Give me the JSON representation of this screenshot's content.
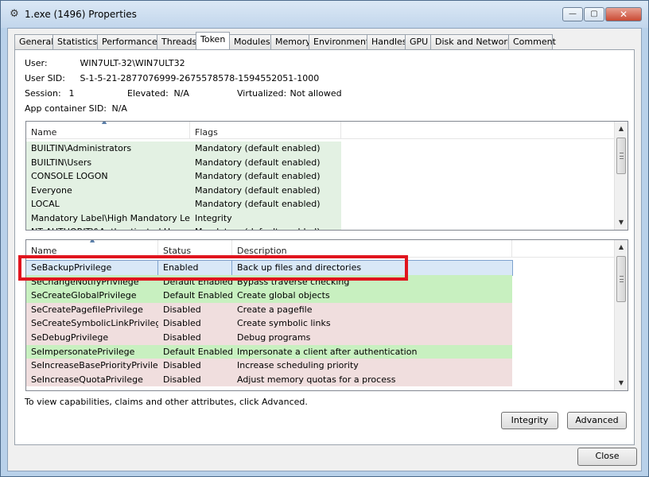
{
  "window": {
    "title": "1.exe (1496) Properties",
    "close_label": "✕",
    "minimize_label": "—",
    "maximize_label": "▢"
  },
  "tabs": [
    "General",
    "Statistics",
    "Performance",
    "Threads",
    "Token",
    "Modules",
    "Memory",
    "Environment",
    "Handles",
    "GPU",
    "Disk and Network",
    "Comment"
  ],
  "active_tab": "Token",
  "info": {
    "user_label": "User:",
    "user_value": "WIN7ULT-32\\WIN7ULT32",
    "sid_label": "User SID:",
    "sid_value": "S-1-5-21-2877076999-2675578578-1594552051-1000",
    "session_label": "Session:",
    "session_value": "1",
    "elevated_label": "Elevated:",
    "elevated_value": "N/A",
    "virtualized_label": "Virtualized:",
    "virtualized_value": "Not allowed",
    "appcontainer_label": "App container SID:",
    "appcontainer_value": "N/A"
  },
  "groups": {
    "columns": [
      "Name",
      "Flags"
    ],
    "rows": [
      {
        "name": "BUILTIN\\Administrators",
        "flags": "Mandatory (default enabled)"
      },
      {
        "name": "BUILTIN\\Users",
        "flags": "Mandatory (default enabled)"
      },
      {
        "name": "CONSOLE LOGON",
        "flags": "Mandatory (default enabled)"
      },
      {
        "name": "Everyone",
        "flags": "Mandatory (default enabled)"
      },
      {
        "name": "LOCAL",
        "flags": "Mandatory (default enabled)"
      },
      {
        "name": "Mandatory Label\\High Mandatory Level",
        "flags": "Integrity"
      },
      {
        "name": "NT AUTHORITY\\Authenticated Users",
        "flags": "Mandatory (default enabled)"
      }
    ]
  },
  "privileges": {
    "columns": [
      "Name",
      "Status",
      "Description"
    ],
    "rows": [
      {
        "name": "SeBackupPrivilege",
        "status": "Enabled",
        "description": "Back up files and directories",
        "state": "selected"
      },
      {
        "name": "SeChangeNotifyPrivilege",
        "status": "Default Enabled",
        "description": "Bypass traverse checking",
        "state": "default"
      },
      {
        "name": "SeCreateGlobalPrivilege",
        "status": "Default Enabled",
        "description": "Create global objects",
        "state": "default"
      },
      {
        "name": "SeCreatePagefilePrivilege",
        "status": "Disabled",
        "description": "Create a pagefile",
        "state": "disabled"
      },
      {
        "name": "SeCreateSymbolicLinkPrivilege",
        "status": "Disabled",
        "description": "Create symbolic links",
        "state": "disabled"
      },
      {
        "name": "SeDebugPrivilege",
        "status": "Disabled",
        "description": "Debug programs",
        "state": "disabled"
      },
      {
        "name": "SeImpersonatePrivilege",
        "status": "Default Enabled",
        "description": "Impersonate a client after authentication",
        "state": "default"
      },
      {
        "name": "SeIncreaseBasePriorityPrivilege",
        "status": "Disabled",
        "description": "Increase scheduling priority",
        "state": "disabled"
      },
      {
        "name": "SeIncreaseQuotaPrivilege",
        "status": "Disabled",
        "description": "Adjust memory quotas for a process",
        "state": "disabled"
      }
    ]
  },
  "footer_text": "To view capabilities, claims and other attributes, click Advanced.",
  "buttons": {
    "integrity": "Integrity",
    "advanced": "Advanced",
    "close": "Close"
  },
  "colors": {
    "default_enabled_row": "#c8f0c0",
    "group_row": "#e3f1e3",
    "disabled_row": "#f0dede",
    "highlight_box": "#e0141e"
  }
}
